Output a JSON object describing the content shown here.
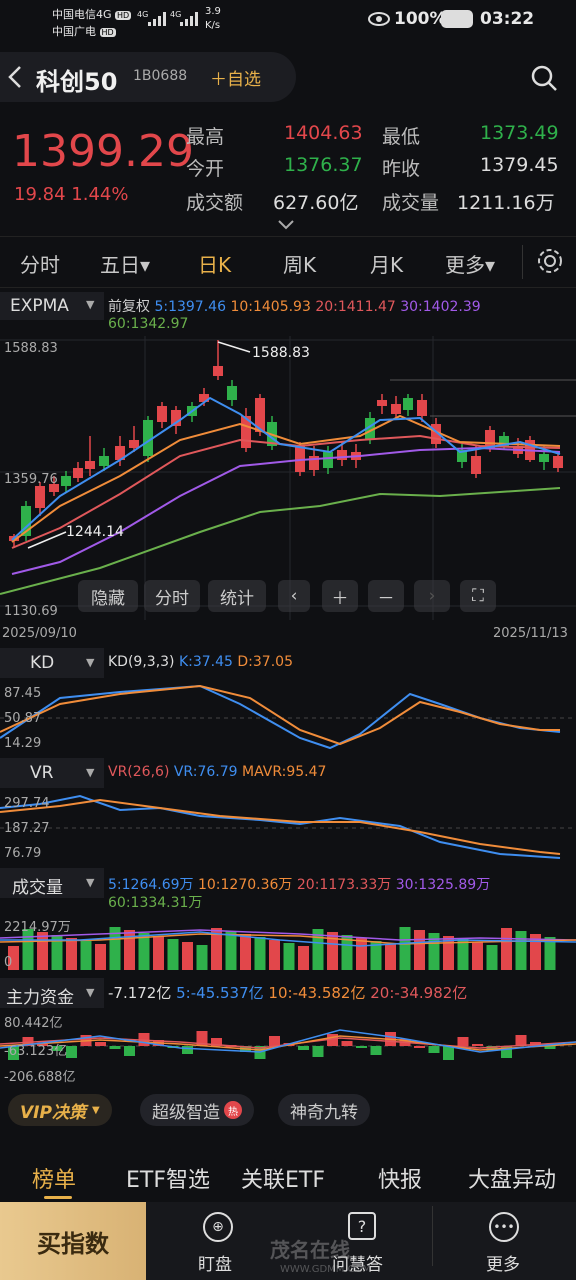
{
  "status": {
    "carrier1": "中国电信4G",
    "carrier1_badge": "HD",
    "carrier2": "中国广电",
    "carrier2_badge": "HD",
    "net1": "4G",
    "net2": "4G",
    "speed_value": "3.9",
    "speed_unit": "K/s",
    "battery": "100%",
    "time": "03:22"
  },
  "header": {
    "title": "科创50",
    "code": "1B0688",
    "add_watch": "自选"
  },
  "quote": {
    "price": "1399.29",
    "change": "19.84",
    "change_pct": "1.44%",
    "high_label": "最高",
    "high": "1404.63",
    "low_label": "最低",
    "low": "1373.49",
    "open_label": "今开",
    "open": "1376.37",
    "prev_label": "昨收",
    "prev": "1379.45",
    "amount_label": "成交额",
    "amount": "627.60亿",
    "volume_label": "成交量",
    "volume": "1211.16万"
  },
  "tabs": [
    "分时",
    "五日▾",
    "日K",
    "周K",
    "月K",
    "更多▾"
  ],
  "active_tab": "日K",
  "main_chart": {
    "indicator": "EXPMA",
    "adjust": "前复权",
    "ma5": "5:1397.46",
    "ma10": "10:1405.93",
    "ma20": "20:1411.47",
    "ma30": "30:1402.39",
    "ma60": "60:1342.97",
    "y_top": "1588.83",
    "y_mid": "1359.76",
    "y_bottom": "1130.69",
    "high_note": "1588.83",
    "low_note": "1244.14",
    "date_start": "2025/09/10",
    "date_end": "2025/11/13",
    "ctrl_hide": "隐藏",
    "ctrl_time": "分时",
    "ctrl_stat": "统计"
  },
  "kd": {
    "name": "KD",
    "params": "KD(9,3,3)",
    "k": "K:37.45",
    "d": "D:37.05",
    "y1": "87.45",
    "y2": "50.87",
    "y3": "14.29"
  },
  "vr": {
    "name": "VR",
    "params": "VR(26,6)",
    "vr": "VR:76.79",
    "mavr": "MAVR:95.47",
    "y1": "297.74",
    "y2": "187.27",
    "y3": "76.79"
  },
  "vol": {
    "name": "成交量",
    "ma5": "5:1264.69万",
    "ma10": "10:1270.36万",
    "ma20": "20:1173.33万",
    "ma30": "30:1325.89万",
    "ma60": "60:1334.31万",
    "y1": "2214.97万",
    "y2": "0"
  },
  "fund": {
    "name": "主力资金",
    "value": "-7.172亿",
    "ma5": "5:-45.537亿",
    "ma10": "10:-43.582亿",
    "ma20": "20:-34.982亿",
    "y1": "80.442亿",
    "y2": "-63.123亿",
    "y3": "-206.688亿"
  },
  "chips": {
    "vip": "VIP决策",
    "super": "超级智造",
    "hot": "热",
    "nine": "神奇九转"
  },
  "bottom_tabs": [
    "榜单",
    "ETF智选",
    "关联ETF",
    "快报",
    "大盘异动"
  ],
  "footer": {
    "buy": "买指数",
    "watch": "盯盘",
    "ask": "问慧答",
    "more": "更多",
    "watermark": "茂名在线",
    "watermark_url": "WWW.GDMM.COM"
  },
  "colors": {
    "up": "#e2474b",
    "down": "#2fb14b",
    "ma5": "#3f8ef0",
    "ma10": "#f08c3a",
    "ma20": "#e0585b",
    "ma30": "#a15ae8",
    "ma60": "#6ab04c"
  }
}
